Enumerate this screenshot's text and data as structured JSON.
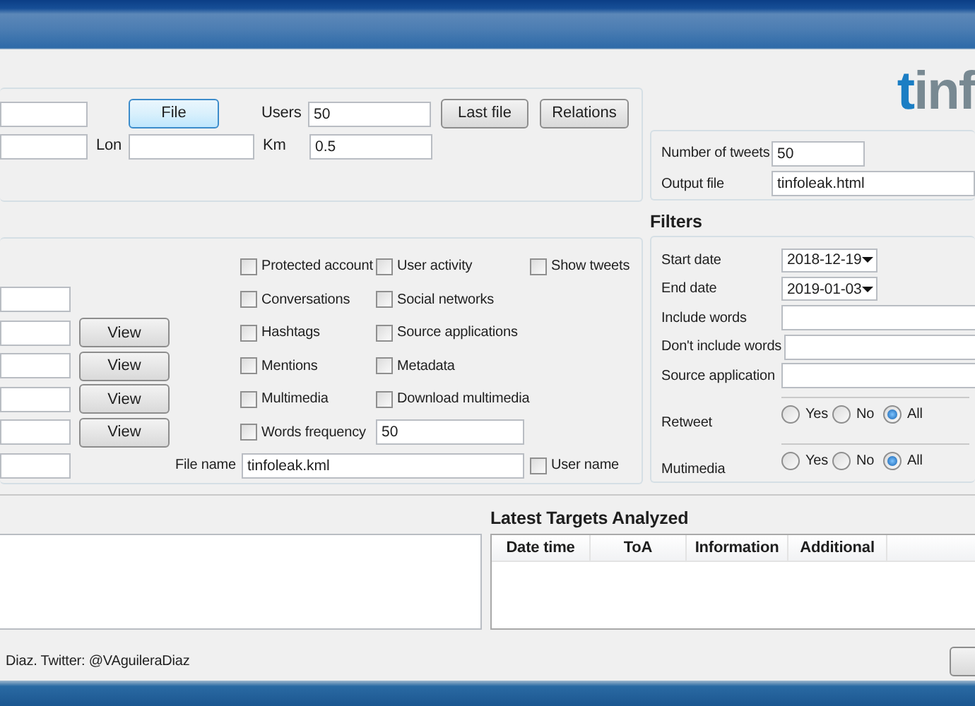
{
  "search_panel": {
    "rows": [
      {
        "items": [
          {
            "kind": "field",
            "value": ""
          },
          {
            "kind": "button",
            "label": "File",
            "focused": true
          },
          {
            "kind": "labeled_field",
            "label": "Users",
            "value": "50"
          },
          {
            "kind": "button",
            "label": "Last file",
            "focused": false
          },
          {
            "kind": "button",
            "label": "Relations",
            "focused": false
          }
        ]
      },
      {
        "items": [
          {
            "kind": "field",
            "value": ""
          },
          {
            "kind": "labeled_field",
            "label": "Lon",
            "value": ""
          },
          {
            "kind": "labeled_field",
            "label": "Km",
            "value": "0.5"
          }
        ]
      }
    ]
  },
  "logo": {
    "accent": "t",
    "rest": "inf"
  },
  "output": [
    {
      "label": "Number of tweets",
      "value": "50"
    },
    {
      "label": "Output file",
      "value": "tinfoleak.html"
    }
  ],
  "options": {
    "rows": [
      {
        "left": {
          "kind": "none"
        },
        "items": [
          {
            "kind": "checkbox",
            "label": "Protected account",
            "checked": false
          },
          {
            "kind": "checkbox",
            "label": "User activity",
            "checked": false
          },
          {
            "kind": "checkbox",
            "label": "Show tweets",
            "checked": false
          }
        ]
      },
      {
        "left": {
          "kind": "field"
        },
        "items": [
          {
            "kind": "checkbox",
            "label": "Conversations",
            "checked": false
          },
          {
            "kind": "checkbox",
            "label": "Social networks",
            "checked": false
          }
        ]
      },
      {
        "left": {
          "kind": "field_view",
          "button": "View"
        },
        "items": [
          {
            "kind": "checkbox",
            "label": "Hashtags",
            "checked": false
          },
          {
            "kind": "checkbox",
            "label": "Source applications",
            "checked": false
          }
        ]
      },
      {
        "left": {
          "kind": "field_view",
          "button": "View"
        },
        "items": [
          {
            "kind": "checkbox",
            "label": "Mentions",
            "checked": false
          },
          {
            "kind": "checkbox",
            "label": "Metadata",
            "checked": false
          }
        ]
      },
      {
        "left": {
          "kind": "field_view",
          "button": "View"
        },
        "items": [
          {
            "kind": "checkbox",
            "label": "Multimedia",
            "checked": false
          },
          {
            "kind": "checkbox",
            "label": "Download multimedia",
            "checked": false
          }
        ]
      },
      {
        "left": {
          "kind": "field_view",
          "button": "View"
        },
        "items": [
          {
            "kind": "checkbox",
            "label": "Words frequency",
            "checked": false
          },
          {
            "kind": "field",
            "value": "50"
          }
        ]
      },
      {
        "left": {
          "kind": "field_label",
          "label": "File name"
        },
        "items": [
          {
            "kind": "wide_field",
            "value": "tinfoleak.kml"
          },
          {
            "kind": "checkbox",
            "label": "User name",
            "checked": false
          }
        ]
      }
    ]
  },
  "filters": {
    "title": "Filters",
    "rows": [
      {
        "kind": "date",
        "label": "Start date",
        "value": "2018-12-19"
      },
      {
        "kind": "date",
        "label": "End date",
        "value": "2019-01-03"
      },
      {
        "kind": "text",
        "label": "Include words",
        "value": ""
      },
      {
        "kind": "text",
        "label": "Don't include words",
        "value": ""
      },
      {
        "kind": "text",
        "label": "Source application",
        "value": ""
      },
      {
        "kind": "radio",
        "label": "Retweet",
        "options": [
          {
            "label": "Yes",
            "selected": false
          },
          {
            "label": "No",
            "selected": false
          },
          {
            "label": "All",
            "selected": true
          }
        ]
      },
      {
        "kind": "radio",
        "label": "Mutimedia",
        "options": [
          {
            "label": "Yes",
            "selected": false
          },
          {
            "label": "No",
            "selected": false
          },
          {
            "label": "All",
            "selected": true
          }
        ]
      }
    ]
  },
  "latest": {
    "title": "Latest Targets Analyzed",
    "columns": [
      "Date time",
      "ToA",
      "Information",
      "Additional"
    ]
  },
  "footer": {
    "credit": "Diaz. Twitter: @VAguileraDiaz"
  }
}
